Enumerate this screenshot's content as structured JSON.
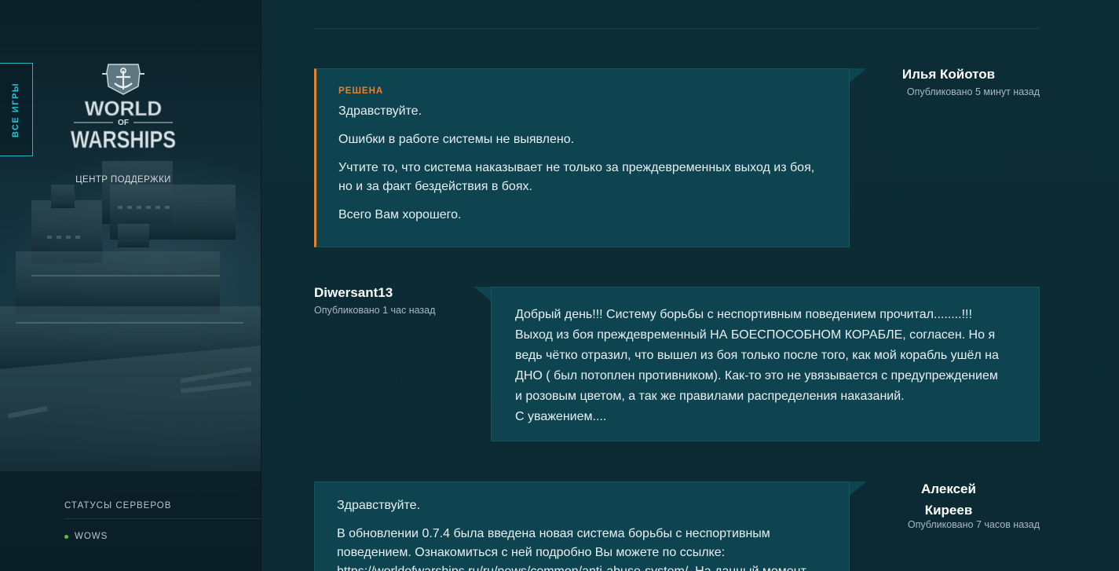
{
  "sidebar": {
    "all_games_label": "ВСЕ ИГРЫ",
    "logo": {
      "line1": "WORLD",
      "line2": "OF",
      "line3": "WARSHIPS"
    },
    "support_center": "ЦЕНТР ПОДДЕРЖКИ",
    "server_status_title": "СТАТУСЫ СЕРВЕРОВ",
    "servers": [
      {
        "name": "WOWS",
        "status_color": "#5fbf3a"
      }
    ]
  },
  "colors": {
    "accent_orange": "#e3832e",
    "accent_cyan": "#2ec2d6",
    "bubble_bg": "#0e4350"
  },
  "messages": [
    {
      "author": "Илья Койотов",
      "published": "Опубликовано 5 минут назад",
      "status": "РЕШЕНА",
      "paragraphs": [
        "Здравствуйте.",
        "Ошибки в работе системы не выявлено.",
        "Учтите то, что система наказывает не только за преждевременных выход из боя, но и за факт бездействия в боях.",
        "Всего Вам хорошего."
      ]
    },
    {
      "author": "Diwersant13",
      "published": "Опубликовано 1 час назад",
      "lines": [
        "Добрый день!!! Систему борьбы с неспортивным поведением прочитал........!!!",
        "Выход из боя преждевременный НА БОЕСПОСОБНОМ КОРАБЛЕ, согласен. Но я",
        "ведь чётко отразил, что вышел из боя только после того, как мой корабль ушёл на",
        "ДНО ( был потоплен противником). Как-то это не увязывается с предупреждением",
        "и розовым цветом, а так же правилами распределения наказаний.",
        "С уважением...."
      ]
    },
    {
      "author_line1": "Алексей",
      "author_line2": "Киреев",
      "published": "Опубликовано 7 часов назад",
      "paragraph1": "Здравствуйте.",
      "paragraph2_start": "В обновлении 0.7.4 была введена новая система борьбы с неспортивным поведением. Ознакомиться с ней подробно Вы можете по ссылке: ",
      "link": "https://worldofwarships.ru/ru/news/common/anti-abuse-system/",
      "paragraph2_end": ". На данный момент"
    }
  ]
}
